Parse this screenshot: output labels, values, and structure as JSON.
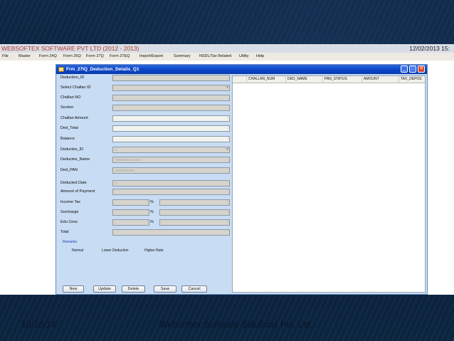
{
  "app": {
    "title": "WEBSOFTEX  SOFTWARE PVT LTD (2012 - 2013)",
    "date": "12/02/2013  15:"
  },
  "menu": [
    "File",
    "Master",
    "Form 24Q",
    "Form 26Q",
    "Form 27Q",
    "Form 27EQ",
    "Import/Export",
    "Summary",
    "NSDL/Tax Related",
    "Utility",
    "Help"
  ],
  "form": {
    "title": "Frm_27IQ_Deduction_Details_Q1",
    "fields": {
      "deduction_id": {
        "label": "Deduction_ID",
        "value": ""
      },
      "select_challan_id": {
        "label": "Select Challan ID",
        "value": ""
      },
      "challan_no": {
        "label": "Challan NO",
        "value": ""
      },
      "section": {
        "label": "Section",
        "value": ""
      },
      "challan_amount": {
        "label": "Challan Amount",
        "value": ""
      },
      "ded_total": {
        "label": "Ded_Total",
        "value": ""
      },
      "balance": {
        "label": "Balance",
        "value": ""
      },
      "deductee_id": {
        "label": "Deductee_ID",
        "value": "1"
      },
      "deductee_name": {
        "label": "Deductee_Name",
        "value": "SAMSUNG & CO.,"
      },
      "ded_pan": {
        "label": "Ded_PAN",
        "value": "ACM7E6G5H"
      },
      "deducted_date": {
        "label": "Deducted Date",
        "value": "/  /"
      },
      "amount_of_payment": {
        "label": "Amount of Payment",
        "value": ""
      },
      "income_tax": {
        "label": "Income Tax",
        "value": ""
      },
      "surcharge": {
        "label": "Surcharge",
        "value": ""
      },
      "edu_cess": {
        "label": "Edu Cess",
        "value": ""
      },
      "total": {
        "label": "Total",
        "value": ""
      }
    },
    "percent_sign": "%",
    "remarks_label": "Remarks",
    "remark_options": [
      "Normal",
      "Lower Deduction",
      "Higher Rate"
    ],
    "buttons": {
      "new": "New",
      "update": "Update",
      "delete": "Delete",
      "save": "Save",
      "cancel": "Cancel"
    }
  },
  "grid": {
    "columns": [
      "CHALLAN_NUM",
      "DED_NAME",
      "PAN_STATUS",
      "AMOUNT",
      "TAX_DEPOS"
    ]
  },
  "footer": {
    "date": "10/18/14",
    "company": "Websoftex Software Solutions Pvt. Ltd."
  }
}
